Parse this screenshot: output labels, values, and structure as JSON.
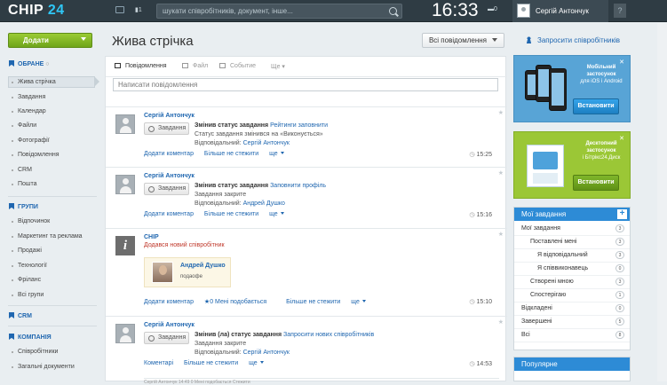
{
  "topbar": {
    "logo_name": "CHIP",
    "logo_num": "24",
    "badge": "1",
    "search_placeholder": "шукати співробітників, документ, інше...",
    "clock": "16:33",
    "toggle": "0",
    "user_name": "Сергій Антончук",
    "help": "?"
  },
  "sidebar": {
    "add_button": "Додати",
    "sections": [
      {
        "title": "ОБРАНЕ",
        "extra": "○",
        "items": [
          "Жива стрічка",
          "Завдання",
          "Календар",
          "Файли",
          "Фотографії",
          "Повідомлення",
          "CRM",
          "Пошта"
        ]
      },
      {
        "title": "ГРУПИ",
        "items": [
          "Відпочинок",
          "Маркетинг та реклама",
          "Продажі",
          "Технології",
          "Фріланс",
          "Всі групи"
        ]
      },
      {
        "title": "CRM",
        "items": []
      },
      {
        "title": "КОМПАНІЯ",
        "items": [
          "Співробітники",
          "Загальні документи"
        ]
      }
    ]
  },
  "main": {
    "title": "Жива стрічка",
    "filter_label": "Всі повідомлення",
    "invite_label": "Запросити співробітників"
  },
  "composer": {
    "tabs": [
      "Повідомлення",
      "Файл",
      "Событие",
      "Ще"
    ],
    "placeholder": "Написати повідомлення"
  },
  "posts": [
    {
      "author": "Сергій Антончук",
      "tag": "Завдання",
      "line1_prefix": "Змінив статус завдання",
      "line1_link": "Рейтинги заповнити",
      "line2": "Статус завдання змінився на «Виконується»",
      "resp_label": "Відповідальний:",
      "resp_name": "Сергій Антончук",
      "actions": [
        "Додати коментар",
        "Більше не стежити",
        "ще"
      ],
      "time": "15:25"
    },
    {
      "author": "Сергій Антончук",
      "tag": "Завдання",
      "line1_prefix": "Змінив статус завдання",
      "line1_link": "Заповнити профіль",
      "line2": "Завдання закрите",
      "resp_label": "Відповідальний:",
      "resp_name": "Андрей Душко",
      "actions": [
        "Додати коментар",
        "Більше не стежити",
        "ще"
      ],
      "time": "15:16"
    },
    {
      "author": "CHIP",
      "note": "Додався новий співробітник",
      "card_name": "Андрей Душко",
      "card_position": "подаофе",
      "actions": [
        "Додати коментар",
        "0 Мені подобається",
        "Більше не стежити",
        "ще"
      ],
      "time": "15:10"
    },
    {
      "author": "Сергій Антончук",
      "tag": "Завдання",
      "line1_prefix": "Змінив (ла) статус завдання",
      "line1_link": "Запросити нових співробітників",
      "line2": "Завдання закрите",
      "resp_label": "Відповідальний:",
      "resp_name": "Сергій Антончук",
      "actions": [
        "Коментарі",
        "Більше не стежити",
        "ще"
      ],
      "time": "14:53",
      "sub": "Сергій Антончук  14:49  0 Мені подобається  Стежити"
    }
  ],
  "right": {
    "promo_mobile": {
      "title": "Мобільний застосунок",
      "sub": "для iOS і Android",
      "button": "Встановити"
    },
    "promo_desktop": {
      "title": "Десктопний застосунок",
      "sub": "і Бітрікс24.Диск",
      "button": "Встановити"
    },
    "tasks": {
      "title": "Мої завдання",
      "rows": [
        {
          "label": "Мої завдання",
          "count": "3",
          "indent": 0
        },
        {
          "label": "Поставлені мені",
          "count": "3",
          "indent": 1
        },
        {
          "label": "Я відповідальний",
          "count": "3",
          "indent": 2
        },
        {
          "label": "Я співвиконавець",
          "count": "0",
          "indent": 2
        },
        {
          "label": "Створені мною",
          "count": "3",
          "indent": 1
        },
        {
          "label": "Спостерігаю",
          "count": "1",
          "indent": 1
        },
        {
          "label": "Відкладені",
          "count": "0",
          "indent": 0
        },
        {
          "label": "Завершені",
          "count": "5",
          "indent": 0
        },
        {
          "label": "Всі",
          "count": "8",
          "indent": 0
        }
      ]
    },
    "popular_title": "Популярне"
  },
  "colors": {
    "accent": "#2067b0",
    "header": "#2d8bd6",
    "add_green": "#7fb62b",
    "topbar": "#2f3c44"
  }
}
